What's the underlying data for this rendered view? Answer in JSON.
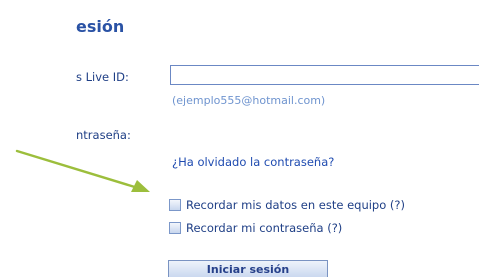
{
  "form": {
    "heading": "esión",
    "id_label": "s Live ID:",
    "id_value": "",
    "id_hint": "(ejemplo555@hotmail.com)",
    "password_label": "ntraseña:",
    "forgot_link": "¿Ha olvidado la contraseña?",
    "remember_data_label": "Recordar mis datos en este equipo (?)",
    "remember_data_checked": false,
    "remember_password_label": "Recordar mi contraseña (?)",
    "remember_password_checked": false,
    "submit_label": "Iniciar sesión"
  },
  "annotation": {
    "arrow_color": "#9cbe3c",
    "icon": "arrow-pointer-icon"
  },
  "colors": {
    "heading": "#2a52a5",
    "label": "#1f3f86",
    "hint": "#6f94cf",
    "link": "#1f4bb0"
  }
}
